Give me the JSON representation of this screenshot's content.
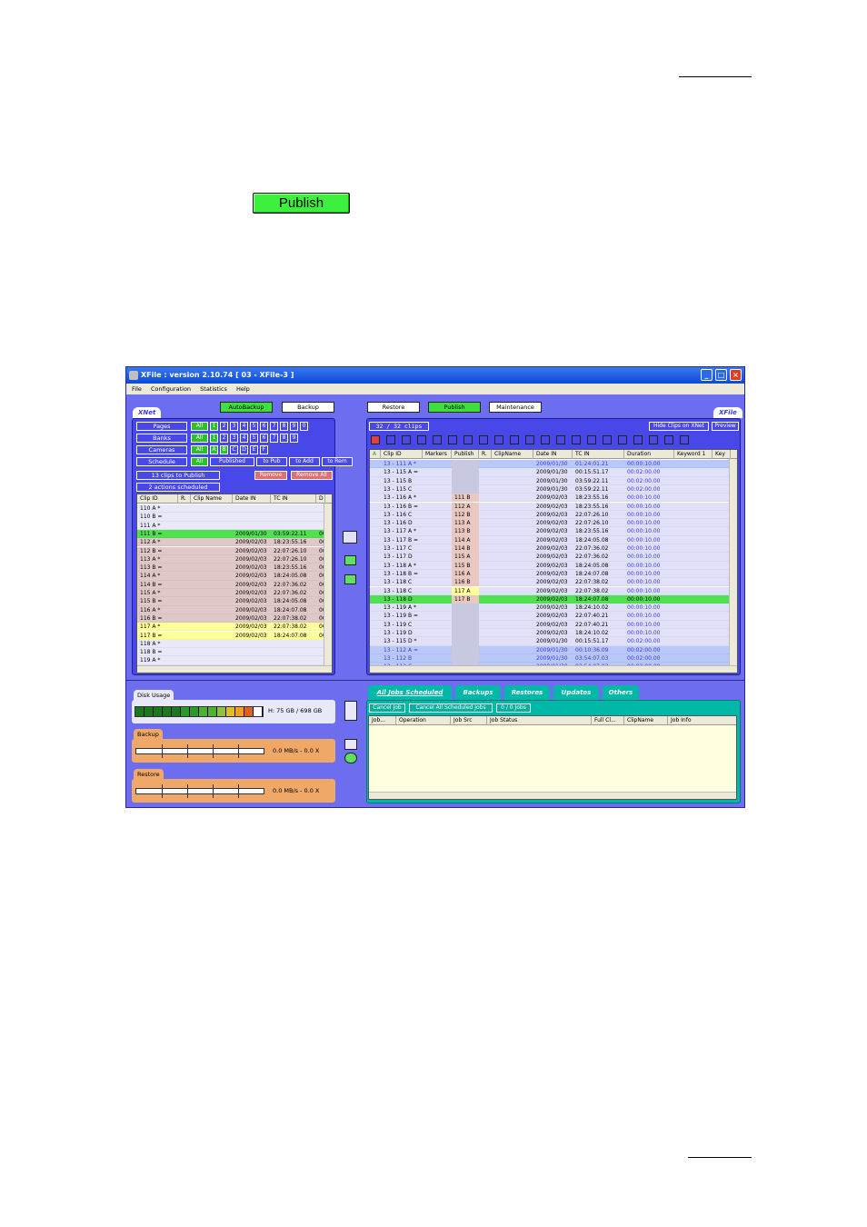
{
  "publish_button_label": "Publish",
  "window": {
    "title": "XFile : version 2.10.74 [ 03 - XFile-3 ]",
    "menu": [
      "File",
      "Configuration",
      "Statistics",
      "Help"
    ],
    "top_buttons": {
      "autobackup": "AutoBackup",
      "backup": "Backup",
      "restore": "Restore",
      "publish": "Publish",
      "maintenance": "Maintenance"
    },
    "colors": {
      "frame": "#6d6df0",
      "panel": "#4848e8",
      "green": "#3ee03e",
      "teal": "#00b8a8",
      "orange": "#f0a868"
    }
  },
  "xnet": {
    "tag": "XNet",
    "filters": [
      {
        "label": "Pages",
        "buttons": [
          "All",
          "1",
          "2",
          "3",
          "4",
          "5",
          "6",
          "7",
          "8",
          "9",
          "0"
        ]
      },
      {
        "label": "Banks",
        "buttons": [
          "All",
          "1",
          "2",
          "3",
          "4",
          "5",
          "6",
          "7",
          "8",
          "9"
        ]
      },
      {
        "label": "Cameras",
        "buttons": [
          "All",
          "A",
          "B",
          "C",
          "D",
          "E",
          "F"
        ]
      },
      {
        "label": "Schedule",
        "buttons": [
          "All",
          "Published",
          "to Pub",
          "to Add",
          "to Rem"
        ]
      }
    ],
    "clips_to_publish": "13 clips to Publish",
    "remove": "Remove",
    "remove_all": "Remove All",
    "actions_scheduled": "2 actions scheduled",
    "columns": [
      "Clip ID",
      "R.",
      "Clip Name",
      "Date IN",
      "TC IN",
      "D"
    ],
    "rows": [
      {
        "id": "110 A *",
        "date": "",
        "tc": "",
        "d": "",
        "bg": "#e8e8f8"
      },
      {
        "id": "110 B =",
        "date": "",
        "tc": "",
        "d": "",
        "bg": "#e8e8f8"
      },
      {
        "id": "111 A *",
        "date": "",
        "tc": "",
        "d": "",
        "bg": "#e8e8f8"
      },
      {
        "id": "111 B =",
        "date": "2009/01/30",
        "tc": "03:59:22.11",
        "d": "00",
        "bg": "#50e050"
      },
      {
        "id": "112 A *",
        "date": "2009/02/03",
        "tc": "18:23:55.16",
        "d": "00",
        "bg": "#e0c8c8"
      },
      {
        "id": "112 B =",
        "date": "2009/02/03",
        "tc": "22:07:26.10",
        "d": "00",
        "bg": "#e0c8c8"
      },
      {
        "id": "113 A *",
        "date": "2009/02/03",
        "tc": "22:07:26.10",
        "d": "00",
        "bg": "#e0c8c8"
      },
      {
        "id": "113 B =",
        "date": "2009/02/03",
        "tc": "18:23:55.16",
        "d": "00",
        "bg": "#e0c8c8"
      },
      {
        "id": "114 A *",
        "date": "2009/02/03",
        "tc": "18:24:05.08",
        "d": "00",
        "bg": "#e0c8c8"
      },
      {
        "id": "114 B =",
        "date": "2009/02/03",
        "tc": "22:07:36.02",
        "d": "00",
        "bg": "#e0c8c8"
      },
      {
        "id": "115 A *",
        "date": "2009/02/03",
        "tc": "22:07:36.02",
        "d": "00",
        "bg": "#e0c8c8"
      },
      {
        "id": "115 B =",
        "date": "2009/02/03",
        "tc": "18:24:05.08",
        "d": "00",
        "bg": "#e0c8c8"
      },
      {
        "id": "116 A *",
        "date": "2009/02/03",
        "tc": "18:24:07.08",
        "d": "00",
        "bg": "#e0c8c8"
      },
      {
        "id": "116 B =",
        "date": "2009/02/03",
        "tc": "22:07:38.02",
        "d": "00",
        "bg": "#e0c8c8"
      },
      {
        "id": "117 A *",
        "date": "2009/02/03",
        "tc": "22:07:38.02",
        "d": "00",
        "bg": "#ffff9a"
      },
      {
        "id": "117 B =",
        "date": "2009/02/03",
        "tc": "18:24:07.08",
        "d": "00",
        "bg": "#ffff9a"
      },
      {
        "id": "118 A *",
        "date": "",
        "tc": "",
        "d": "",
        "bg": "#e8e8f8"
      },
      {
        "id": "118 B =",
        "date": "",
        "tc": "",
        "d": "",
        "bg": "#e8e8f8"
      },
      {
        "id": "119 A *",
        "date": "",
        "tc": "",
        "d": "",
        "bg": "#e8e8f8"
      }
    ]
  },
  "xfile": {
    "tag": "XFile",
    "clip_count": "32 / 32 clips",
    "hide_clips": "Hide Clips on XNet",
    "preview": "Preview",
    "columns": [
      "Clip ID",
      "Markers",
      "Publish",
      "R.",
      "ClipName",
      "Date IN",
      "TC IN",
      "Duration",
      "Keyword 1",
      "Key"
    ],
    "rows": [
      {
        "id": "13 - 111 A *",
        "pub": "",
        "date": "2009/01/30",
        "tc": "01:24:01.21",
        "dur": "00:00:10.00",
        "bg": "#b8c8f8",
        "fg": "#3a3ad8"
      },
      {
        "id": "13 - 115 A =",
        "pub": "",
        "date": "2009/01/30",
        "tc": "00:15:51.17",
        "dur": "00:02:00.00",
        "bg": "#e0e0f8",
        "fg": "#000"
      },
      {
        "id": "13 - 115 B",
        "pub": "",
        "date": "2009/01/30",
        "tc": "03:59:22.11",
        "dur": "00:02:00.00",
        "bg": "#e0e0f8",
        "fg": "#000"
      },
      {
        "id": "13 - 115 C",
        "pub": "",
        "date": "2009/01/30",
        "tc": "03:59:22.11",
        "dur": "00:02:00.00",
        "bg": "#e0e0f8",
        "fg": "#000"
      },
      {
        "id": "13 - 116 A *",
        "pub": "111 B",
        "date": "2009/02/03",
        "tc": "18:23:55.16",
        "dur": "00:00:10.00",
        "bg": "#e0e0f8",
        "fg": "#000"
      },
      {
        "id": "13 - 116 B =",
        "pub": "112 A",
        "date": "2009/02/03",
        "tc": "18:23:55.16",
        "dur": "00:00:10.00",
        "bg": "#e0e0f8",
        "fg": "#000"
      },
      {
        "id": "13 - 116 C",
        "pub": "112 B",
        "date": "2009/02/03",
        "tc": "22:07:26.10",
        "dur": "00:00:10.00",
        "bg": "#e0e0f8",
        "fg": "#000"
      },
      {
        "id": "13 - 116 D",
        "pub": "113 A",
        "date": "2009/02/03",
        "tc": "22:07:26.10",
        "dur": "00:00:10.00",
        "bg": "#e0e0f8",
        "fg": "#000"
      },
      {
        "id": "13 - 117 A *",
        "pub": "113 B",
        "date": "2009/02/03",
        "tc": "18:23:55.16",
        "dur": "00:00:10.00",
        "bg": "#e0e0f8",
        "fg": "#000"
      },
      {
        "id": "13 - 117 B =",
        "pub": "114 A",
        "date": "2009/02/03",
        "tc": "18:24:05.08",
        "dur": "00:00:10.00",
        "bg": "#e0e0f8",
        "fg": "#000"
      },
      {
        "id": "13 - 117 C",
        "pub": "114 B",
        "date": "2009/02/03",
        "tc": "22:07:36.02",
        "dur": "00:00:10.00",
        "bg": "#e0e0f8",
        "fg": "#000"
      },
      {
        "id": "13 - 117 D",
        "pub": "115 A",
        "date": "2009/02/03",
        "tc": "22:07:36.02",
        "dur": "00:00:10.00",
        "bg": "#e0e0f8",
        "fg": "#000"
      },
      {
        "id": "13 - 118 A *",
        "pub": "115 B",
        "date": "2009/02/03",
        "tc": "18:24:05.08",
        "dur": "00:00:10.00",
        "bg": "#e0e0f8",
        "fg": "#000"
      },
      {
        "id": "13 - 118 B =",
        "pub": "116 A",
        "date": "2009/02/03",
        "tc": "18:24:07.08",
        "dur": "00:00:10.00",
        "bg": "#e0e0f8",
        "fg": "#000"
      },
      {
        "id": "13 - 118 C",
        "pub": "116 B",
        "date": "2009/02/03",
        "tc": "22:07:38.02",
        "dur": "00:00:10.00",
        "bg": "#e0e0f8",
        "fg": "#000"
      },
      {
        "id": "13 - 118 C",
        "pub": "117 A",
        "date": "2009/02/03",
        "tc": "22:07:38.02",
        "dur": "00:00:10.00",
        "bg": "#e0e0f8",
        "fg": "#000"
      },
      {
        "id": "13 - 118 D",
        "pub": "117 B",
        "date": "2009/02/03",
        "tc": "18:24:07.08",
        "dur": "00:00:10.00",
        "bg": "#50e050",
        "fg": "#000"
      },
      {
        "id": "13 - 119 A *",
        "pub": "",
        "date": "2009/02/03",
        "tc": "18:24:10.02",
        "dur": "00:00:10.00",
        "bg": "#e0e0f8",
        "fg": "#000"
      },
      {
        "id": "13 - 119 B =",
        "pub": "",
        "date": "2009/02/03",
        "tc": "22:07:40.21",
        "dur": "00:00:10.00",
        "bg": "#e0e0f8",
        "fg": "#000"
      },
      {
        "id": "13 - 119 C",
        "pub": "",
        "date": "2009/02/03",
        "tc": "22:07:40.21",
        "dur": "00:00:10.00",
        "bg": "#e0e0f8",
        "fg": "#000"
      },
      {
        "id": "13 - 119 D",
        "pub": "",
        "date": "2009/02/03",
        "tc": "18:24:10.02",
        "dur": "00:00:10.00",
        "bg": "#e0e0f8",
        "fg": "#000"
      },
      {
        "id": "13 - 115 D *",
        "pub": "",
        "date": "2009/01/30",
        "tc": "00:15:51.17",
        "dur": "00:02:00.00",
        "bg": "#e0e0f8",
        "fg": "#000"
      },
      {
        "id": "13 - 112 A =",
        "pub": "",
        "date": "2009/01/30",
        "tc": "00:10:36.09",
        "dur": "00:02:00.00",
        "bg": "#b8c8f8",
        "fg": "#3a3ad8"
      },
      {
        "id": "13 - 112 B",
        "pub": "",
        "date": "2009/01/30",
        "tc": "03:54:07.03",
        "dur": "00:02:00.00",
        "bg": "#b8c8f8",
        "fg": "#3a3ad8"
      },
      {
        "id": "13 - 112 C",
        "pub": "",
        "date": "2009/01/30",
        "tc": "03:54:07.03",
        "dur": "00:02:00.00",
        "bg": "#b8c8f8",
        "fg": "#3a3ad8"
      }
    ]
  },
  "disk": {
    "tag": "Disk Usage",
    "value": "H: 75 GB / 698 GB",
    "segments": [
      "#1a7a1a",
      "#1a7a1a",
      "#1a7a1a",
      "#1a7a1a",
      "#1a7a1a",
      "#2a9a2a",
      "#2a9a2a",
      "#50b030",
      "#50b030",
      "#90c040",
      "#e0c020",
      "#f0a020",
      "#e06020",
      "#ffffff"
    ]
  },
  "backup": {
    "tag": "Backup",
    "value": "0.0 MB/s - 0.0 X"
  },
  "restore": {
    "tag": "Restore",
    "value": "0.0 MB/s - 0.0 X"
  },
  "jobs": {
    "tabs": [
      "All Jobs Scheduled",
      "Backups",
      "Restores",
      "Updates",
      "Others"
    ],
    "cancel_job": "Cancel Job",
    "cancel_all": "Cancel All Scheduled Jobs",
    "count": "0 / 0 Jobs",
    "columns": [
      "Job...",
      "Operation",
      "Job Src",
      "Job Status",
      "Full Cl...",
      "ClipName",
      "Job Info"
    ]
  }
}
